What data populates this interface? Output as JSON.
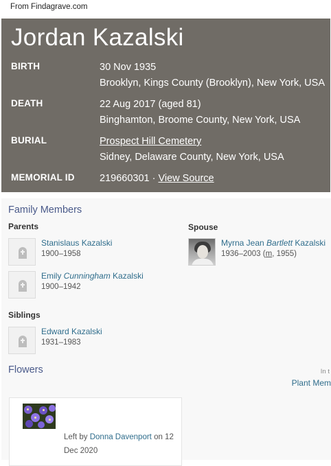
{
  "source_note": "From Findagrave.com",
  "memorial": {
    "name": "Jordan Kazalski",
    "birth": {
      "label": "BIRTH",
      "date": "30 Nov 1935",
      "place": "Brooklyn, Kings County (Brooklyn), New York, USA"
    },
    "death": {
      "label": "DEATH",
      "date": "22 Aug 2017 (aged 81)",
      "place": "Binghamton, Broome County, New York, USA"
    },
    "burial": {
      "label": "BURIAL",
      "cemetery": "Prospect Hill Cemetery",
      "place": "Sidney, Delaware County, New York, USA"
    },
    "memorial_id": {
      "label": "MEMORIAL ID",
      "value": "219660301 · ",
      "view_source": "View Source"
    }
  },
  "family": {
    "title": "Family Members",
    "parents_label": "Parents",
    "spouse_label": "Spouse",
    "siblings_label": "Siblings",
    "parents": [
      {
        "first": "Stanislaus Kazalski",
        "maiden": "",
        "last": "",
        "dates": "1900–1958"
      },
      {
        "first": "Emily ",
        "maiden": "Cunningham",
        "last": " Kazalski",
        "dates": "1900–1942"
      }
    ],
    "spouse": {
      "first": "Myrna Jean ",
      "maiden": "Bartlett",
      "last": " Kazalski",
      "dates_pre": "1936–2003 (",
      "married_abbr": "m",
      "dates_post": ", 1955)"
    },
    "siblings": [
      {
        "name": "Edward Kazalski",
        "dates": "1931–1983"
      }
    ]
  },
  "flowers": {
    "title": "Flowers",
    "int_fragment": "In t",
    "plant_link": "Plant Mem",
    "card": {
      "left_by_prefix": "Left by ",
      "left_by_name": "Donna Davenport",
      "left_by_date": " on 12 Dec 2020"
    }
  },
  "colors": {
    "header_bg": "#706c66",
    "section_heading": "#4a5a8a",
    "link": "#2f6d8c"
  }
}
